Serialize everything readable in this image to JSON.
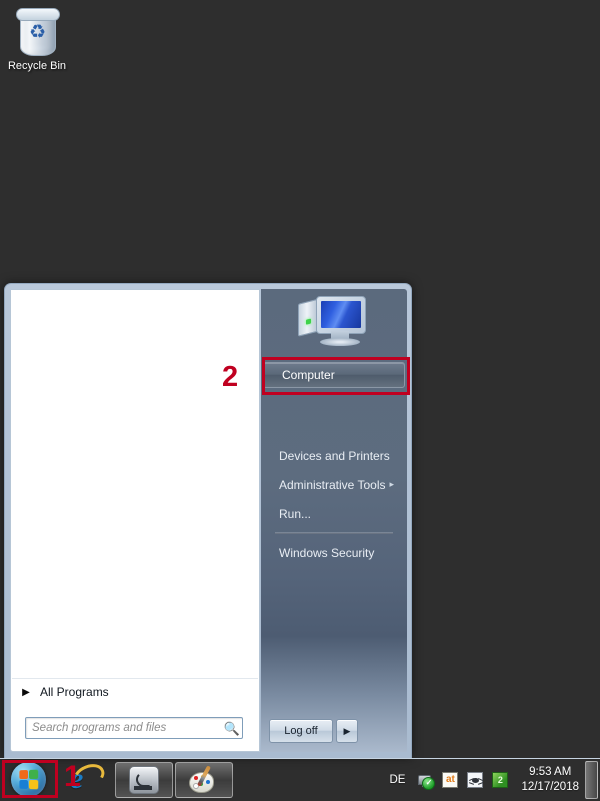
{
  "desktop": {
    "background_color": "#2e2e2e",
    "icons": [
      {
        "name": "recycle-bin",
        "label": "Recycle Bin",
        "icon": "recycle-bin-icon"
      }
    ]
  },
  "start_menu": {
    "left_panel": {
      "programs": [],
      "all_programs": {
        "label": "All Programs",
        "icon": "triangle-right-icon"
      },
      "search": {
        "placeholder": "Search programs and files",
        "value": "",
        "icon": "search-icon"
      }
    },
    "right_panel": {
      "user_picture": "computer-monitor-icon",
      "items": [
        {
          "label": "Computer",
          "highlighted": true,
          "has_submenu": false
        },
        {
          "label": "Devices and Printers",
          "highlighted": false,
          "has_submenu": false
        },
        {
          "label": "Administrative Tools",
          "highlighted": false,
          "has_submenu": true,
          "submenu_arrow": "▸"
        },
        {
          "label": "Run...",
          "highlighted": false,
          "has_submenu": false
        },
        {
          "label": "Windows Security",
          "highlighted": false,
          "has_submenu": false
        }
      ],
      "logoff": {
        "label": "Log off",
        "arrow": "▶"
      }
    }
  },
  "annotations": [
    {
      "id": "1",
      "label": "1",
      "target": "start-orb",
      "color": "#c00020"
    },
    {
      "id": "2",
      "label": "2",
      "target": "computer-menu-item",
      "color": "#c00020"
    }
  ],
  "taskbar": {
    "start_button": {
      "icon": "windows-orb-icon",
      "label": "Start"
    },
    "buttons": [
      {
        "name": "internet-explorer",
        "icon": "internet-explorer-icon",
        "pinned": false
      },
      {
        "name": "windows-explorer",
        "icon": "windows-explorer-icon",
        "pinned": true
      },
      {
        "name": "paint",
        "icon": "paint-icon",
        "pinned": true
      }
    ],
    "tray": {
      "language": "DE",
      "icons": [
        {
          "name": "network-status-icon",
          "badge": "✓"
        },
        {
          "name": "at-icon",
          "label": "at"
        },
        {
          "name": "bug-icon",
          "label": ""
        },
        {
          "name": "green-app-icon",
          "label": "2"
        }
      ],
      "clock": {
        "time": "9:53 AM",
        "date": "12/17/2018"
      },
      "show_desktop": {
        "label": "Show desktop"
      }
    }
  }
}
